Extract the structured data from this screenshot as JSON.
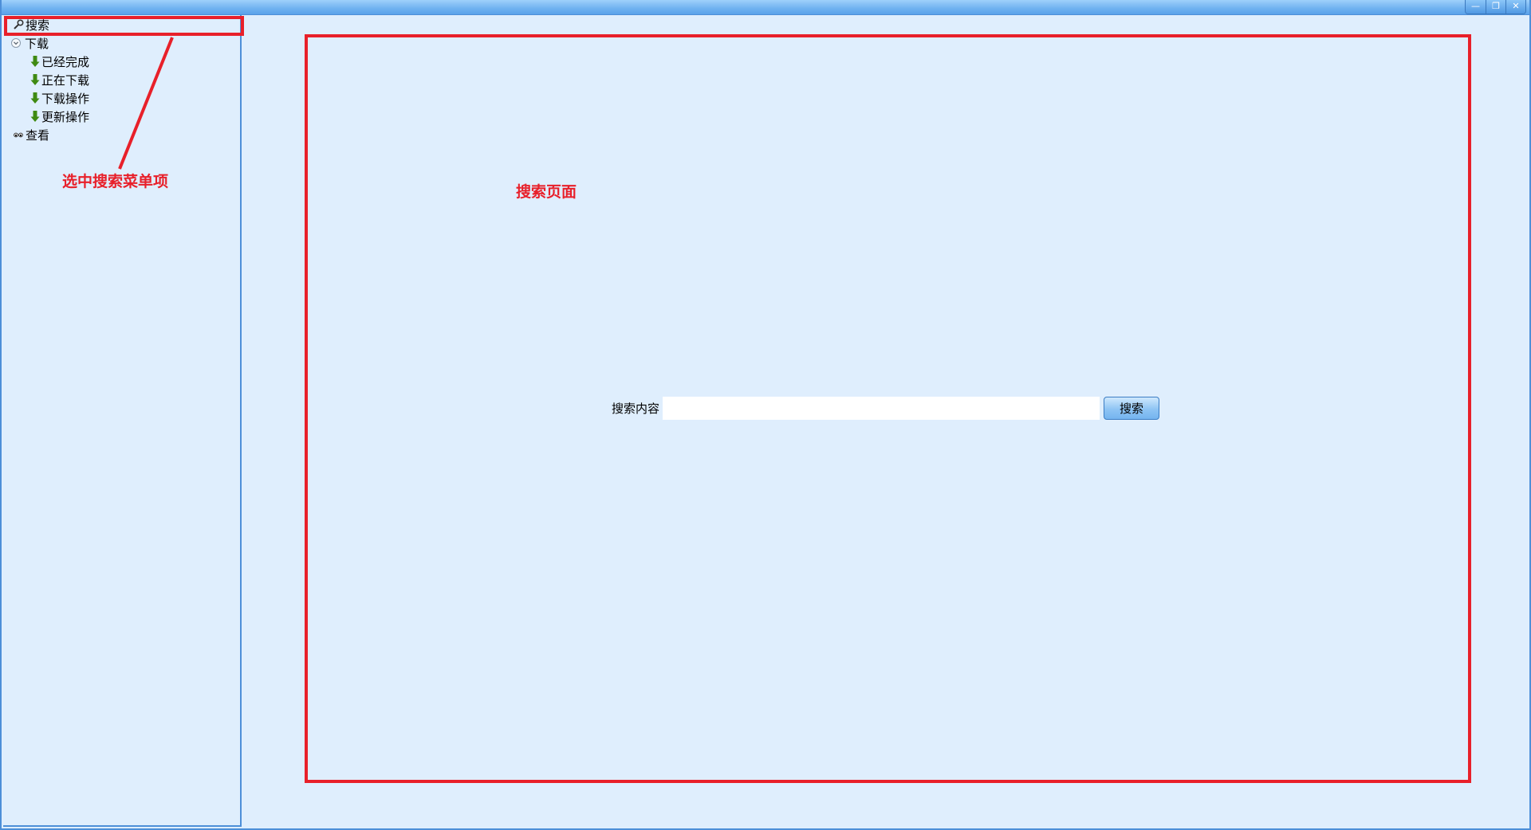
{
  "window": {
    "controls": {
      "minimize_glyph": "—",
      "restore_glyph": "❐",
      "close_glyph": "✕"
    }
  },
  "sidebar": {
    "items": [
      {
        "label": "搜索",
        "icon": "wrench-icon"
      },
      {
        "label": "下载",
        "icon": "expand-circle-icon"
      },
      {
        "label": "已经完成",
        "icon": "download-arrow-icon"
      },
      {
        "label": "正在下载",
        "icon": "download-arrow-icon"
      },
      {
        "label": "下载操作",
        "icon": "download-arrow-icon"
      },
      {
        "label": "更新操作",
        "icon": "download-arrow-icon"
      },
      {
        "label": "查看",
        "icon": "eyes-icon"
      }
    ]
  },
  "main": {
    "search_label": "搜索内容",
    "search_value": "",
    "search_placeholder": "",
    "search_button": "搜索"
  },
  "annotations": {
    "menu_note": "选中搜索菜单项",
    "page_note": "搜索页面",
    "color": "#e8202a"
  },
  "colors": {
    "background": "#dfeefd",
    "border": "#4d8fd8",
    "download_icon": "#3f8a12"
  }
}
